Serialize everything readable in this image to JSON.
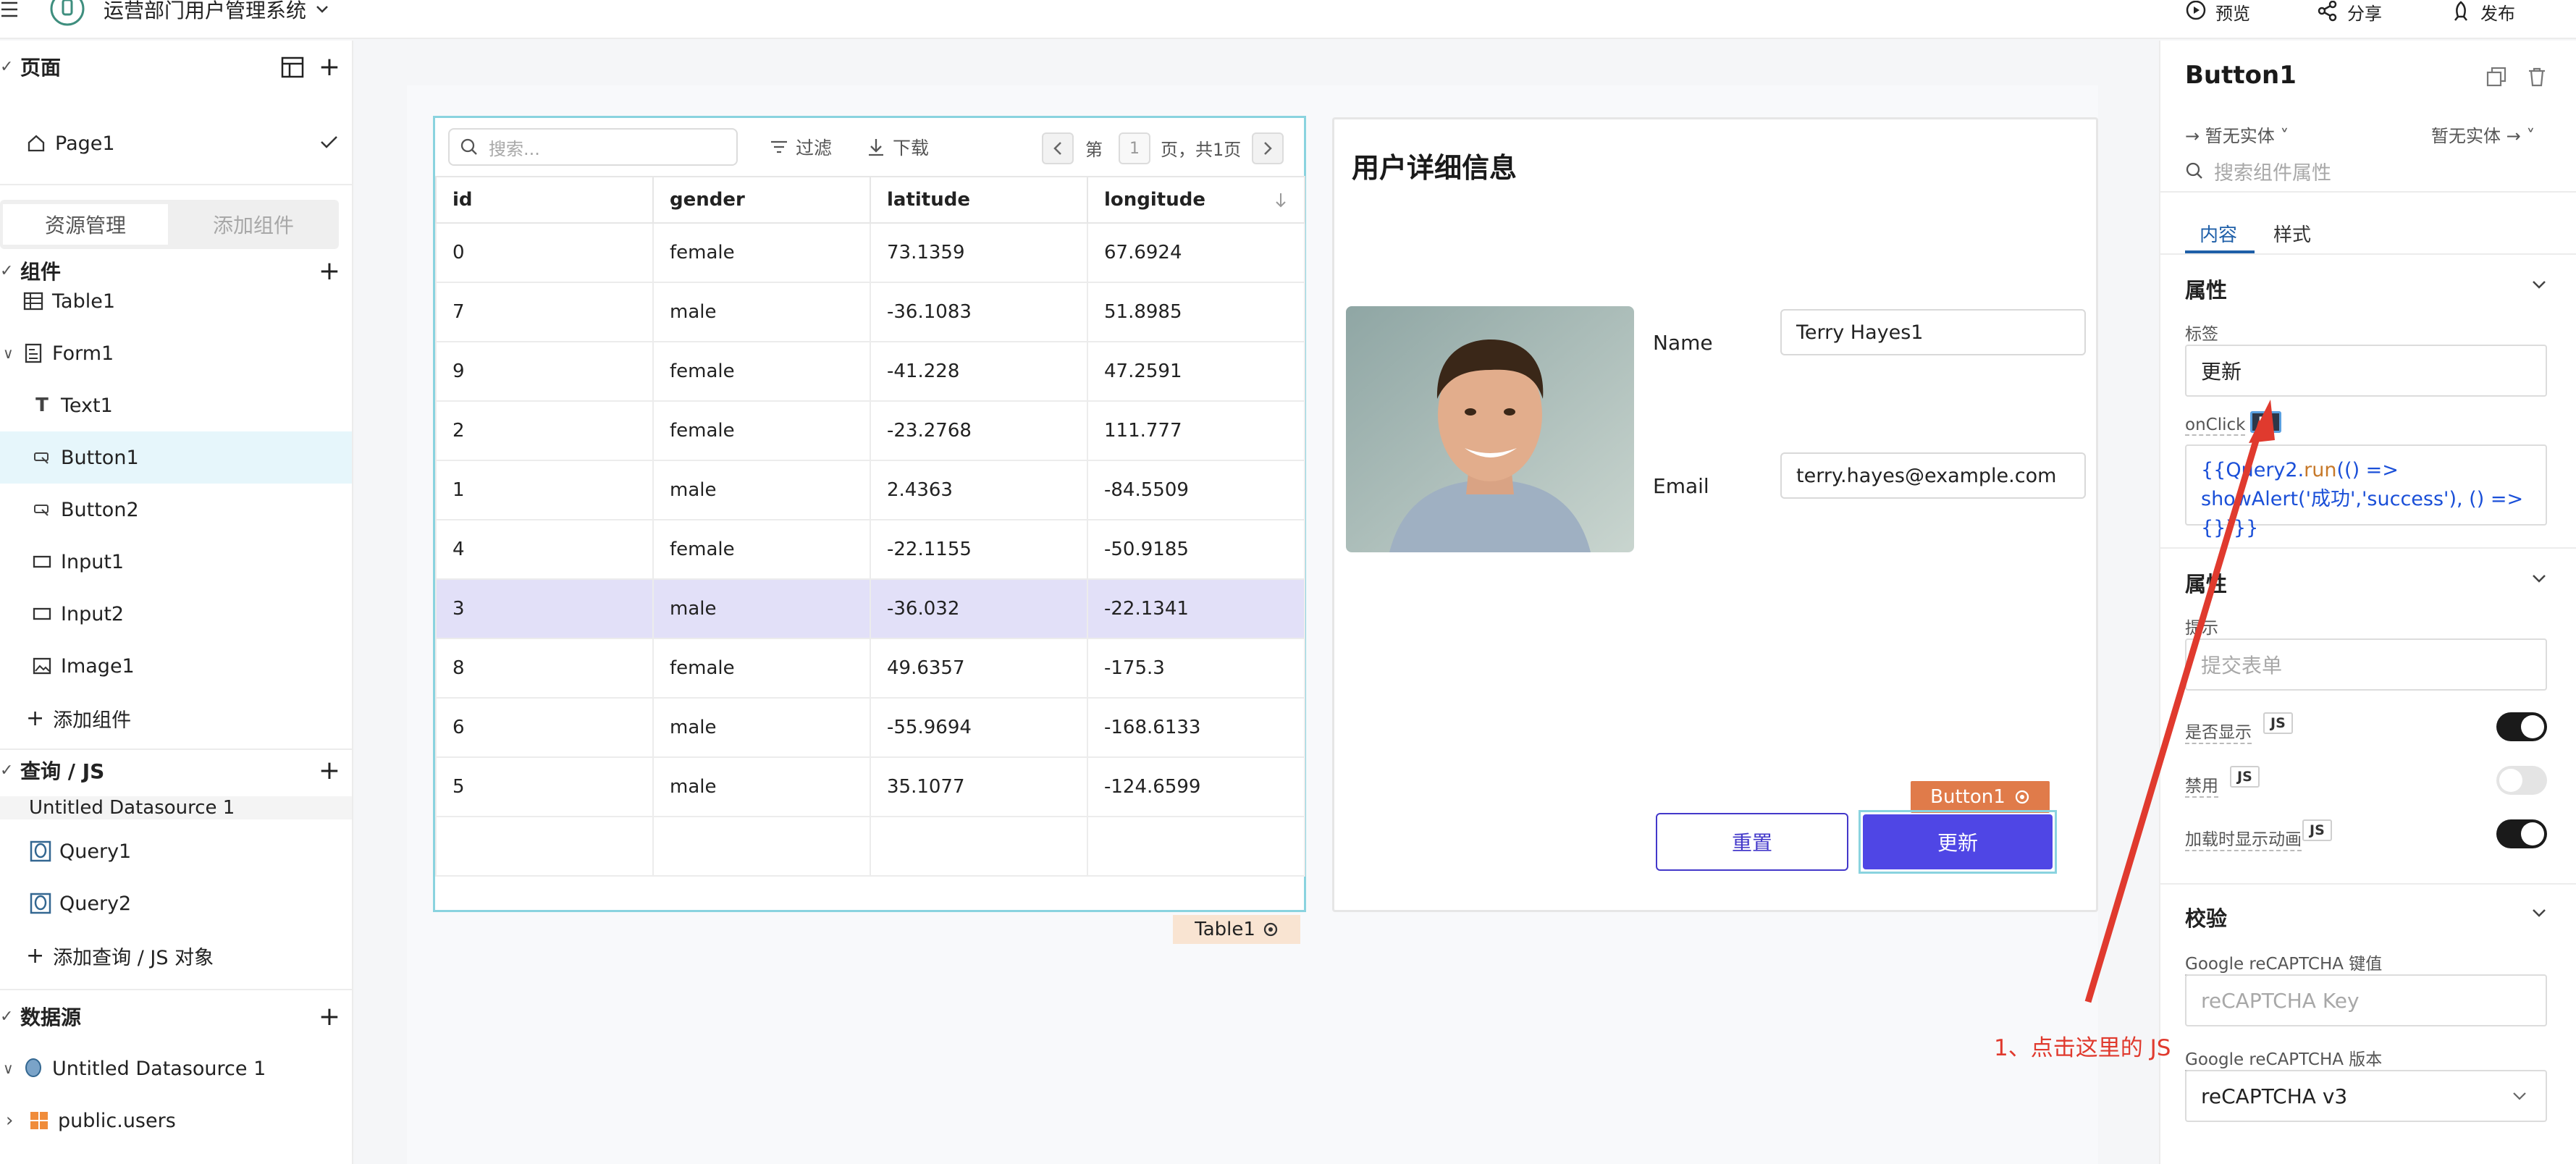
{
  "topbar": {
    "app_title": "运营部门用户管理系统",
    "preview": "预览",
    "share": "分享",
    "publish": "发布"
  },
  "sidebar": {
    "pages_title": "页面",
    "page1": "Page1",
    "tab_resources": "资源管理",
    "tab_add_component": "添加组件",
    "components_title": "组件",
    "components": [
      "Table1",
      "Form1",
      "Text1",
      "Button1",
      "Button2",
      "Input1",
      "Input2",
      "Image1"
    ],
    "add_component": "添加组件",
    "queries_title": "查询 / JS",
    "datasource_group": "Untitled Datasource 1",
    "queries": [
      "Query1",
      "Query2"
    ],
    "add_query": "添加查询 / JS 对象",
    "datasources_title": "数据源",
    "datasource": "Untitled Datasource 1",
    "table_item": "public.users"
  },
  "table": {
    "search_placeholder": "搜索...",
    "filter": "过滤",
    "download": "下载",
    "page_prefix": "第",
    "page_current": "1",
    "page_suffix": "页，共1页",
    "columns": [
      "id",
      "gender",
      "latitude",
      "longitude"
    ],
    "rows": [
      [
        "0",
        "female",
        "73.1359",
        "67.6924"
      ],
      [
        "7",
        "male",
        "-36.1083",
        "51.8985"
      ],
      [
        "9",
        "female",
        "-41.228",
        "47.2591"
      ],
      [
        "2",
        "female",
        "-23.2768",
        "111.777"
      ],
      [
        "1",
        "male",
        "2.4363",
        "-84.5509"
      ],
      [
        "4",
        "female",
        "-22.1155",
        "-50.9185"
      ],
      [
        "3",
        "male",
        "-36.032",
        "-22.1341"
      ],
      [
        "8",
        "female",
        "49.6357",
        "-175.3"
      ],
      [
        "6",
        "male",
        "-55.9694",
        "-168.6133"
      ],
      [
        "5",
        "male",
        "35.1077",
        "-124.6599"
      ]
    ],
    "tag": "Table1"
  },
  "form": {
    "title": "用户详细信息",
    "name_label": "Name",
    "name_value": "Terry Hayes1",
    "email_label": "Email",
    "email_value": "terry.hayes@example.com",
    "reset": "重置",
    "update": "更新",
    "button_tag": "Button1"
  },
  "props": {
    "title": "Button1",
    "entity_left": "暂无实体",
    "entity_right": "暂无实体",
    "search_placeholder": "搜索组件属性",
    "tab_content": "内容",
    "tab_style": "样式",
    "section_props": "属性",
    "label_label": "标签",
    "label_value": "更新",
    "onclick_label": "onClick",
    "js": "JS",
    "section_props2": "属性",
    "tooltip_label": "提示",
    "tooltip_placeholder": "提交表单",
    "visible_label": "是否显示",
    "disabled_label": "禁用",
    "loading_label": "加载时显示动画",
    "section_validation": "校验",
    "recaptcha_key_label": "Google reCAPTCHA 键值",
    "recaptcha_key_placeholder": "reCAPTCHA Key",
    "recaptcha_version_label": "Google reCAPTCHA 版本",
    "recaptcha_version_value": "reCAPTCHA v3"
  },
  "annotation": "1、点击这里的 JS",
  "colors": {
    "accent": "#4f46e5",
    "selection": "#8ad3df",
    "annotation": "#e03a2e"
  }
}
